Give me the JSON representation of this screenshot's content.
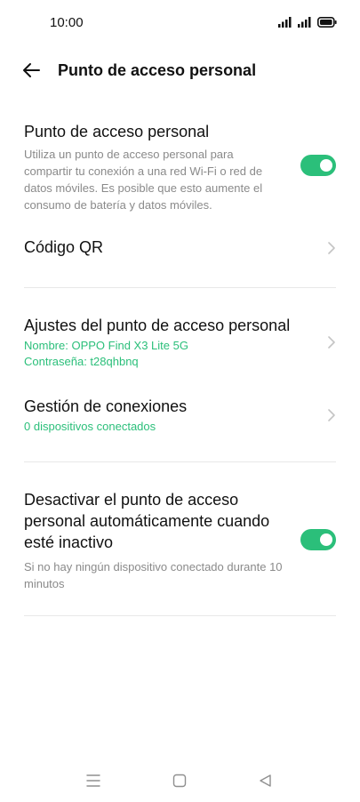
{
  "status_bar": {
    "time": "10:00",
    "icons": [
      "signal-icon",
      "signal-icon",
      "battery-icon"
    ]
  },
  "header": {
    "title": "Punto de acceso personal",
    "back_icon": "arrow-left-icon"
  },
  "hotspot": {
    "title": "Punto de acceso personal",
    "description": "Utiliza un punto de acceso personal para compartir tu conexión a una red Wi-Fi o red de datos móviles. Es posible que esto aumente el consumo de batería y datos móviles.",
    "enabled": true
  },
  "qr_code": {
    "title": "Código QR"
  },
  "hotspot_settings": {
    "title": "Ajustes del punto de acceso personal",
    "name_line": "Nombre: OPPO Find X3 Lite 5G",
    "password_line": "Contraseña: t28qhbnq"
  },
  "connections": {
    "title": "Gestión de conexiones",
    "status": "0 dispositivos conectados"
  },
  "auto_off": {
    "title": "Desactivar el punto de acceso personal automáticamente cuando esté inactivo",
    "description": "Si no hay ningún dispositivo conectado durante 10 minutos",
    "enabled": true
  },
  "colors": {
    "accent": "#2bbf7a",
    "text": "#111111",
    "secondary_text": "#8a8a8a",
    "divider": "#e8e8e8"
  },
  "nav_bar": {
    "icons": [
      "menu-icon",
      "home-square-icon",
      "back-triangle-icon"
    ]
  }
}
